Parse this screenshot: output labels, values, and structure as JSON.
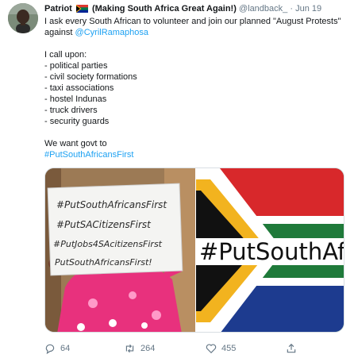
{
  "tweet": {
    "author_name": "Patriot",
    "name_suffix": "(Making South Africa Great Again!)",
    "handle": "@landback_",
    "separator": "·",
    "date": "Jun 19",
    "body": {
      "line1": "I ask every South African to volunteer and join our planned \"August Protests\"",
      "against_word": "against",
      "mention": "@CyrilRamaphosa",
      "call_upon": "I call upon:",
      "list": [
        "- political parties",
        "- civil society formations",
        "- taxi associations",
        "- hostel Indunas",
        "- truck drivers",
        "- security guards"
      ],
      "closing": "We want govt to",
      "hashtag": "#PutSouthAfricansFirst"
    },
    "media": {
      "left_sign_lines": [
        "#PutSouthAfricansFirst",
        "#PutSACitizensFirst",
        "#PutJobs4SAcitizensFirst",
        "PutSouthAfricansFirst!"
      ],
      "right_text": "#PutSouthAf"
    },
    "actions": {
      "replies": "64",
      "retweets": "264",
      "likes": "455"
    },
    "icons": [
      "avatar",
      "south-africa-flag-icon",
      "reply-icon",
      "retweet-icon",
      "like-icon",
      "share-icon"
    ],
    "colors": {
      "link": "#1da1f2",
      "secondary_text": "#657786",
      "flag_green": "#007a4d",
      "flag_red": "#de3831",
      "flag_blue": "#002395",
      "flag_gold": "#ffb612"
    }
  }
}
